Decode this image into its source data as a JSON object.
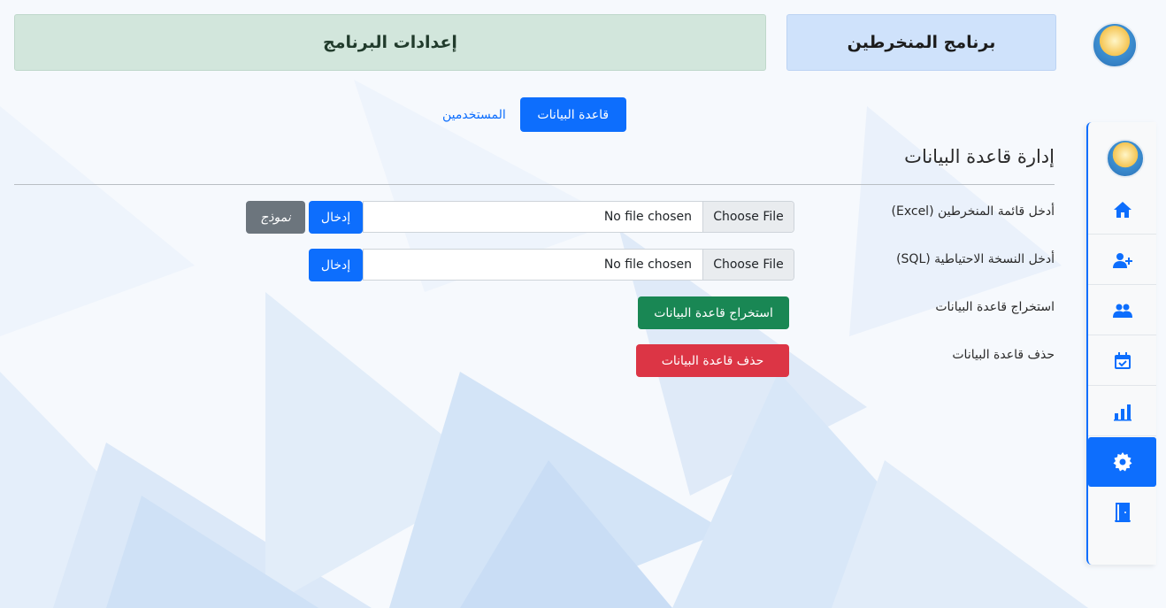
{
  "header": {
    "app_title": "برنامج المنخرطين",
    "settings_title": "إعدادات البرنامج"
  },
  "tabs": {
    "database": "قاعدة البيانات",
    "users": "المستخدمين"
  },
  "section": {
    "title": "إدارة قاعدة البيانات"
  },
  "rows": {
    "excel": {
      "label": "أدخل قائمة المنخرطين (Excel)",
      "choose_label": "Choose File",
      "status": "No file chosen",
      "submit_label": "إدخال",
      "template_label": "نموذج"
    },
    "sql": {
      "label": "أدخل النسخة الاحتياطية (SQL)",
      "choose_label": "Choose File",
      "status": "No file chosen",
      "submit_label": "إدخال"
    },
    "export": {
      "label": "استخراج قاعدة البيانات",
      "button_label": "استخراج قاعدة البيانات"
    },
    "delete": {
      "label": "حذف قاعدة البيانات",
      "button_label": "حذف قاعدة البيانات"
    }
  },
  "sidebar": {
    "items": [
      {
        "icon": "home-icon"
      },
      {
        "icon": "user-plus-icon"
      },
      {
        "icon": "users-icon"
      },
      {
        "icon": "calendar-check-icon"
      },
      {
        "icon": "bar-chart-icon"
      },
      {
        "icon": "gear-icon",
        "active": true
      },
      {
        "icon": "door-exit-icon"
      }
    ]
  },
  "colors": {
    "primary": "#0d6efd",
    "success": "#198754",
    "danger": "#dc3545",
    "secondary": "#6c757d",
    "app_header_bg": "#cfe2fb",
    "settings_header_bg": "#d2e6dc"
  }
}
